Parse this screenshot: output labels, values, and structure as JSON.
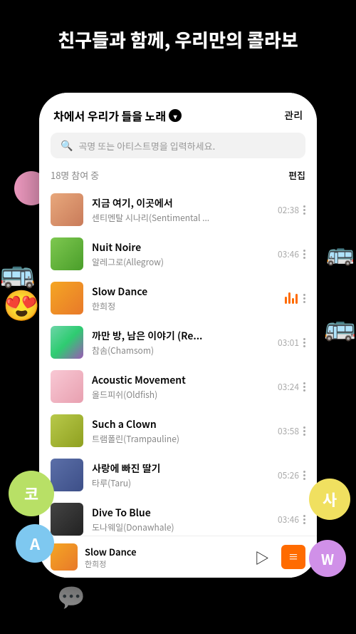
{
  "hero": {
    "line1": "친구들과 함께, 우리만의 콜라보"
  },
  "phone": {
    "header": {
      "playlist_title": "차에서 우리가 들을 노래",
      "manage_label": "관리"
    },
    "search": {
      "placeholder": "곡명 또는 아티스트명을 입력하세요."
    },
    "participant": {
      "count_label": "18명 참여 중",
      "edit_label": "편집"
    },
    "tracks": [
      {
        "name": "지금 여기, 이곳에서",
        "artist": "센티멘탈 시나리(Sentimental ...",
        "duration": "02:38",
        "thumb_class": "thumb-1",
        "playing": false
      },
      {
        "name": "Nuit Noire",
        "artist": "알레그로(Allegrow)",
        "duration": "03:46",
        "thumb_class": "thumb-2",
        "playing": false
      },
      {
        "name": "Slow Dance",
        "artist": "한희정",
        "duration": "",
        "thumb_class": "thumb-3",
        "playing": true
      },
      {
        "name": "까만 방, 남은 이야기 (Re...",
        "artist": "참솜(Chamsom)",
        "duration": "03:01",
        "thumb_class": "thumb-4",
        "playing": false
      },
      {
        "name": "Acoustic Movement",
        "artist": "올드피쉬(Oldfish)",
        "duration": "03:24",
        "thumb_class": "thumb-5",
        "playing": false
      },
      {
        "name": "Such a Clown",
        "artist": "트램폴린(Trampauline)",
        "duration": "03:58",
        "thumb_class": "thumb-6",
        "playing": false
      },
      {
        "name": "사랑에 빠진 딸기",
        "artist": "타루(Taru)",
        "duration": "05:26",
        "thumb_class": "thumb-7",
        "playing": false
      },
      {
        "name": "Dive To Blue",
        "artist": "도나웨일(Donawhale)",
        "duration": "03:46",
        "thumb_class": "thumb-8",
        "playing": false
      }
    ],
    "now_playing": {
      "title": "Slow Dance",
      "artist": "한희정"
    }
  },
  "floats": {
    "ko_label": "코",
    "a_label": "A",
    "sa_label": "사",
    "w_label": "W"
  }
}
